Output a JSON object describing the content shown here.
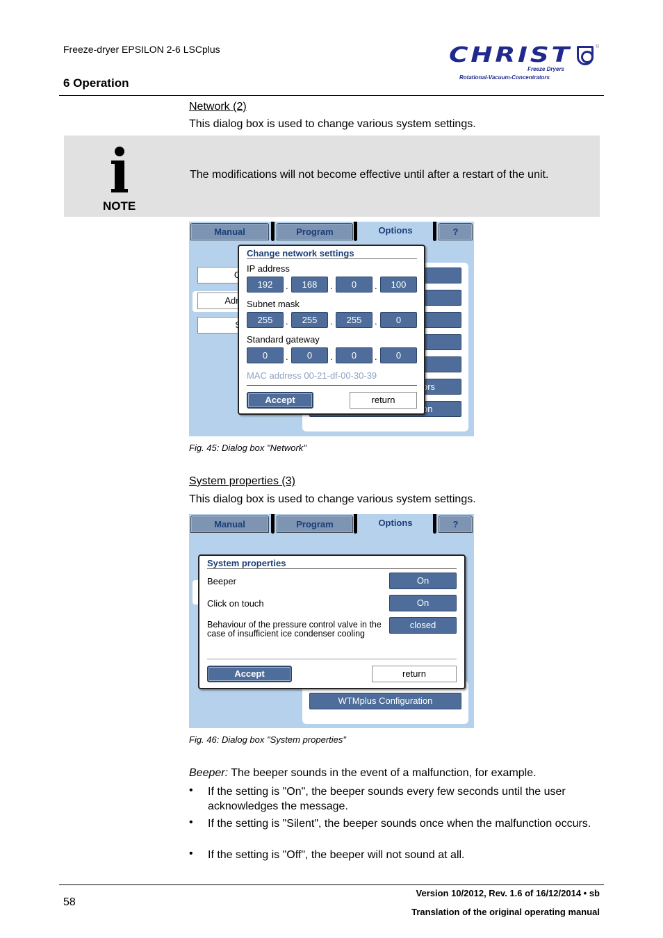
{
  "header": {
    "doc_title": "Freeze-dryer EPSILON 2-6 LSCplus",
    "section_title": "6 Operation",
    "logo": {
      "brand": "CHRIST",
      "registered": "®",
      "tagline_1": "Freeze Dryers",
      "tagline_2": "Rotational-Vacuum-Concentrators",
      "brand_color": "#1f2a8c"
    }
  },
  "network_section": {
    "heading": "Network (2)",
    "description": "This dialog box is used to change various system settings."
  },
  "note": {
    "icon": "info-icon",
    "label": "NOTE",
    "text": "The modifications will not become effective until after a restart of the unit."
  },
  "figure_45": {
    "tabs": [
      {
        "label": "Manual",
        "active": false
      },
      {
        "label": "Program",
        "active": false
      },
      {
        "label": "Options",
        "active": true
      },
      {
        "label": "?",
        "active": false
      }
    ],
    "background_buttons_left": [
      "G",
      "Admi",
      "S"
    ],
    "background_buttons_right": [
      "",
      "",
      "",
      "",
      "",
      "ors",
      "on"
    ],
    "dialog": {
      "title": "Change network settings",
      "ip_label": "IP address",
      "ip": [
        "192",
        "168",
        "0",
        "100"
      ],
      "subnet_label": "Subnet mask",
      "subnet": [
        "255",
        "255",
        "255",
        "0"
      ],
      "gateway_label": "Standard gateway",
      "gateway": [
        "0",
        "0",
        "0",
        "0"
      ],
      "separator": ".",
      "mac": "MAC address 00-21-df-00-30-39",
      "accept": "Accept",
      "return": "return"
    },
    "caption": "Fig. 45: Dialog box \"Network\""
  },
  "system_section": {
    "heading": "System properties (3)",
    "description": "This dialog box is used to change various system settings."
  },
  "figure_46": {
    "tabs": [
      {
        "label": "Manual",
        "active": false
      },
      {
        "label": "Program",
        "active": false
      },
      {
        "label": "Options",
        "active": true
      },
      {
        "label": "?",
        "active": false
      }
    ],
    "dialog": {
      "title": "System properties",
      "rows": [
        {
          "label": "Beeper",
          "value": "On"
        },
        {
          "label": "Click on touch",
          "value": "On"
        },
        {
          "label": "Behaviour of the pressure control valve in the case of insufficient ice condenser cooling",
          "value": "closed"
        }
      ],
      "accept": "Accept",
      "return": "return"
    },
    "background_button": "WTMplus Configuration",
    "caption": "Fig. 46: Dialog box \"System properties\""
  },
  "beeper_text": {
    "term": "Beeper:",
    "intro": " The beeper sounds in the event of a malfunction, for example.",
    "bullet_char": "•",
    "bullets": [
      "If the setting is \"On\", the beeper sounds every few seconds until the user acknowledges the message.",
      "If the setting is \"Silent\", the beeper sounds once when the malfunction occurs.",
      "If the setting is \"Off\", the beeper will not sound at all."
    ]
  },
  "footer": {
    "page_number": "58",
    "version": "Version 10/2012, Rev. 1.6 of 16/12/2014 • sb",
    "translation": "Translation of the original operating manual"
  },
  "colors": {
    "screen_bg": "#b6d1ec",
    "button_blue": "#4e6d9a",
    "title_blue": "#1c3f78",
    "note_bg": "#e1e1e1"
  }
}
